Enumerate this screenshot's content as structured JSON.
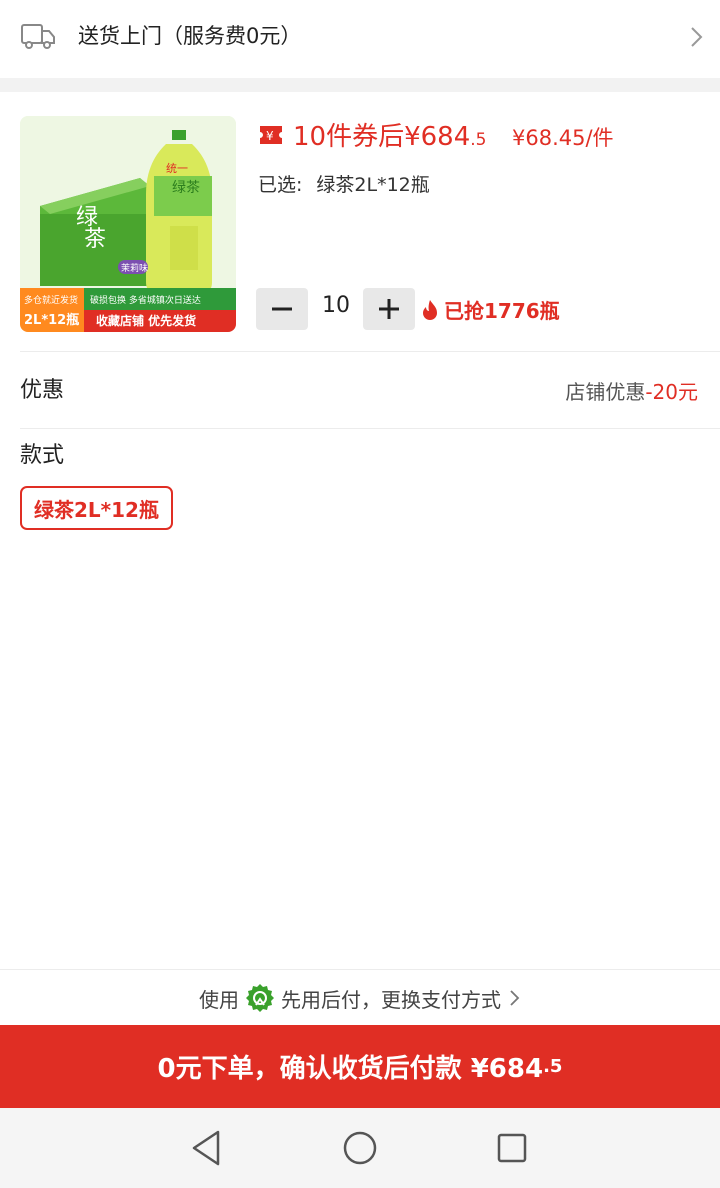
{
  "delivery": {
    "label": "送货上门（服务费0元）",
    "icon": "truck-icon"
  },
  "product": {
    "image": {
      "brand": "统一",
      "name": "绿茶",
      "badge": "茉莉味",
      "banner_left_top": "多仓就近发货",
      "banner_left_bottom": "2L*12瓶",
      "banner_right_top": "破损包换  多省城镇次日送达",
      "banner_right_bottom": "收藏店铺  优先发货"
    },
    "price_text": "10件券后¥684",
    "price_decimal": ".5",
    "unit_price": "¥68.45/件",
    "selected_label": "已选:",
    "selected_value": "绿茶2L*12瓶",
    "quantity": "10",
    "sold": "已抢1776瓶"
  },
  "promo": {
    "label": "优惠",
    "value_label": "店铺优惠",
    "value_amount": "-20元"
  },
  "style": {
    "label": "款式",
    "option": "绿茶2L*12瓶"
  },
  "payment": {
    "prefix": "使用",
    "method": "先用后付，更换支付方式"
  },
  "cta": {
    "label": "0元下单，确认收货后付款 ¥684",
    "decimal": ".5"
  },
  "colors": {
    "accent": "#e02e24",
    "gray_bg": "#f2f2f2",
    "green": "#3aa12c"
  }
}
